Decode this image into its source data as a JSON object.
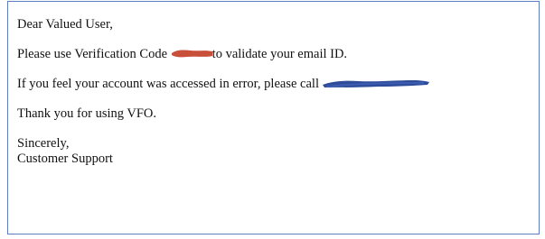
{
  "email": {
    "greeting": "Dear Valued User,",
    "verification_before": "Please use Verification Code ",
    "verification_after": "to validate your email ID.",
    "account_before": "If you feel your account was accessed in error, please call ",
    "thanks": "Thank you for using VFO.",
    "closing": "Sincerely,",
    "signature": "Customer Support"
  },
  "redactions": {
    "code_color": "#c8503a",
    "phone_color": "#2e4c9a"
  }
}
